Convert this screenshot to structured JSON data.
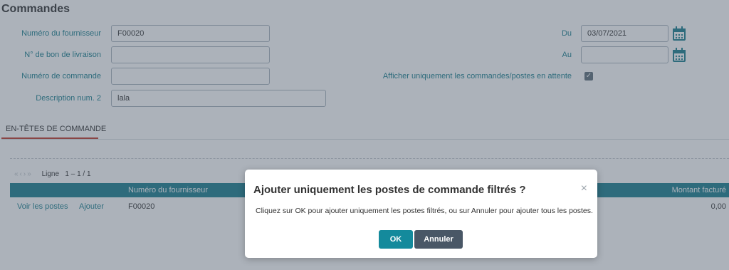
{
  "page": {
    "title": "Commandes"
  },
  "filters": {
    "supplier_number": {
      "label": "Numéro du fournisseur",
      "value": "F00020"
    },
    "delivery_note": {
      "label": "N° de bon de livraison",
      "value": ""
    },
    "order_number": {
      "label": "Numéro de commande",
      "value": ""
    },
    "description2": {
      "label": "Description num. 2",
      "value": "lala"
    },
    "date_from": {
      "label": "Du",
      "value": "03/07/2021"
    },
    "date_to": {
      "label": "Au",
      "value": ""
    },
    "pending_only": {
      "label": "Afficher uniquement les commandes/postes en attente",
      "checked": true,
      "check_glyph": "✓"
    }
  },
  "tabs": [
    {
      "label": "EN-TÊTES DE COMMANDE",
      "active": true
    }
  ],
  "pager": {
    "arrows": "«‹›»",
    "label": "Ligne",
    "range": "1 – 1 / 1"
  },
  "table": {
    "columns": {
      "supplier_number": "Numéro du fournisseur",
      "amount_invoiced": "Montant facturé"
    },
    "rows": [
      {
        "view_items": "Voir les postes",
        "add": "Ajouter",
        "supplier_number": "F00020",
        "amount_invoiced": "0,00"
      }
    ]
  },
  "dialog": {
    "title": "Ajouter uniquement les postes de commande filtrés ?",
    "close_glyph": "×",
    "message": "Cliquez sur OK pour ajouter uniquement les postes filtrés, ou sur Annuler pour ajouter tous les postes.",
    "ok_label": "OK",
    "cancel_label": "Annuler"
  },
  "colors": {
    "accent": "#1a7f8e",
    "tab_underline": "#c0392b",
    "cancel_button": "#495766"
  }
}
